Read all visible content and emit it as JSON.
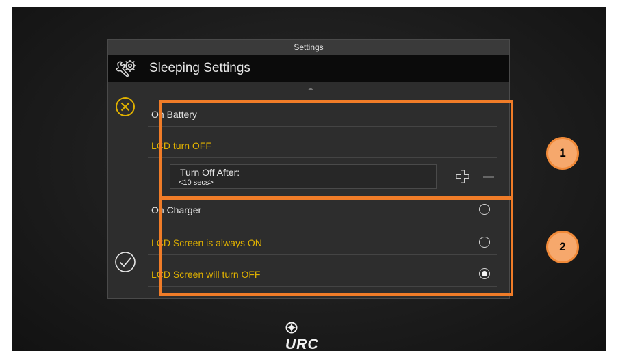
{
  "header": {
    "top_label": "Settings",
    "title": "Sleeping Settings"
  },
  "icons": {
    "settings": "wrench-gear-icon",
    "cancel": "close-circle-icon",
    "confirm": "check-circle-icon",
    "increase": "plus-icon",
    "decrease": "minus-icon"
  },
  "battery": {
    "section_label": "On Battery",
    "option_label": "LCD turn OFF",
    "turn_off_label": "Turn Off After:",
    "turn_off_value": "<10 secs>"
  },
  "charger": {
    "section_label": "On Charger",
    "options": [
      {
        "label": "LCD Screen is always ON",
        "selected": false
      },
      {
        "label": "LCD Screen will turn OFF",
        "selected": true
      }
    ]
  },
  "annotations": {
    "badge_1": "1",
    "badge_2": "2"
  },
  "brand": {
    "logo": "URC"
  },
  "colors": {
    "accent": "#e0b100",
    "highlight": "#f07c28",
    "badge_fill": "#f6a86c"
  }
}
